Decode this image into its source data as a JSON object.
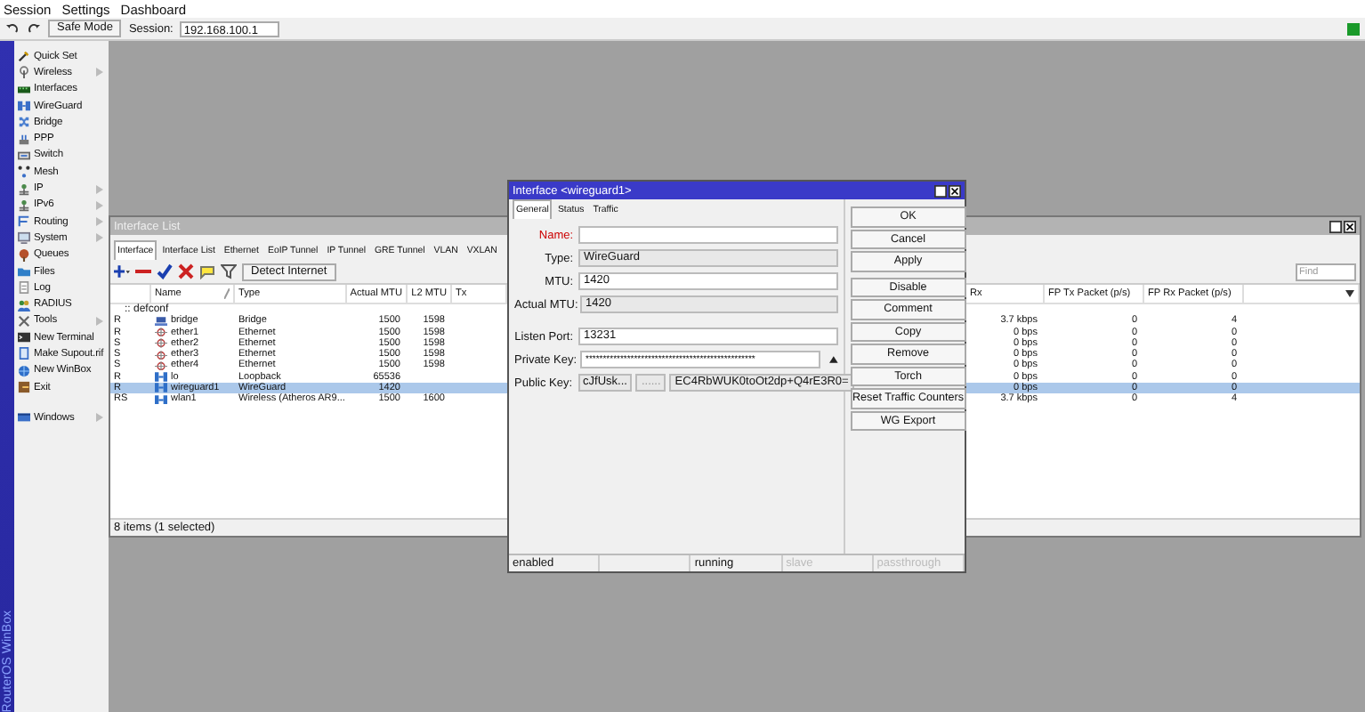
{
  "menu_bar": [
    "Session",
    "Settings",
    "Dashboard"
  ],
  "toolbar": {
    "safe_mode": "Safe Mode",
    "session_label": "Session:",
    "session_value": "192.168.100.1"
  },
  "sidebar": {
    "brand": "RouterOS WinBox",
    "items": [
      {
        "label": "Quick Set",
        "submenu": false
      },
      {
        "label": "Wireless",
        "submenu": true
      },
      {
        "label": "Interfaces",
        "submenu": false
      },
      {
        "label": "WireGuard",
        "submenu": false
      },
      {
        "label": "Bridge",
        "submenu": false
      },
      {
        "label": "PPP",
        "submenu": false
      },
      {
        "label": "Switch",
        "submenu": false
      },
      {
        "label": "Mesh",
        "submenu": false
      },
      {
        "label": "IP",
        "submenu": true
      },
      {
        "label": "IPv6",
        "submenu": true
      },
      {
        "label": "Routing",
        "submenu": true
      },
      {
        "label": "System",
        "submenu": true
      },
      {
        "label": "Queues",
        "submenu": false
      },
      {
        "label": "Files",
        "submenu": false
      },
      {
        "label": "Log",
        "submenu": false
      },
      {
        "label": "RADIUS",
        "submenu": false
      },
      {
        "label": "Tools",
        "submenu": true
      },
      {
        "label": "New Terminal",
        "submenu": false
      },
      {
        "label": "Make Supout.rif",
        "submenu": false
      },
      {
        "label": "New WinBox",
        "submenu": false
      },
      {
        "label": "Exit",
        "submenu": false
      }
    ],
    "bottom_items": [
      {
        "label": "Windows",
        "submenu": true
      }
    ]
  },
  "interface_list": {
    "title": "Interface List",
    "tabs": [
      {
        "label": "Interface",
        "selected": true
      },
      {
        "label": "Interface List",
        "selected": false
      },
      {
        "label": "Ethernet",
        "selected": false
      },
      {
        "label": "EoIP Tunnel",
        "selected": false
      },
      {
        "label": "IP Tunnel",
        "selected": false
      },
      {
        "label": "GRE Tunnel",
        "selected": false
      },
      {
        "label": "VLAN",
        "selected": false
      },
      {
        "label": "VXLAN",
        "selected": false
      }
    ],
    "detect_button": "Detect Internet",
    "find": {
      "placeholder": "Find"
    },
    "columns": [
      "Name",
      "Type",
      "Actual MTU",
      "L2 MTU",
      "Tx",
      "Rx",
      "FP Tx Packet (p/s)",
      "FP Rx Packet (p/s)"
    ],
    "group": ":: defconf",
    "rows": [
      {
        "flags": "R",
        "kind": "bridge",
        "name": "bridge",
        "type": "Bridge",
        "actual_mtu": "1500",
        "l2_mtu": "1598",
        "rx": "3.7 kbps",
        "fp_tx": "0",
        "fp_rx": "4",
        "selected": false
      },
      {
        "flags": "R",
        "kind": "ethernet",
        "name": "ether1",
        "type": "Ethernet",
        "actual_mtu": "1500",
        "l2_mtu": "1598",
        "rx": "0 bps",
        "fp_tx": "0",
        "fp_rx": "0",
        "selected": false
      },
      {
        "flags": "S",
        "kind": "ethernet",
        "name": "ether2",
        "type": "Ethernet",
        "actual_mtu": "1500",
        "l2_mtu": "1598",
        "rx": "0 bps",
        "fp_tx": "0",
        "fp_rx": "0",
        "selected": false
      },
      {
        "flags": "S",
        "kind": "ethernet",
        "name": "ether3",
        "type": "Ethernet",
        "actual_mtu": "1500",
        "l2_mtu": "1598",
        "rx": "0 bps",
        "fp_tx": "0",
        "fp_rx": "0",
        "selected": false
      },
      {
        "flags": "S",
        "kind": "ethernet",
        "name": "ether4",
        "type": "Ethernet",
        "actual_mtu": "1500",
        "l2_mtu": "1598",
        "rx": "0 bps",
        "fp_tx": "0",
        "fp_rx": "0",
        "selected": false
      },
      {
        "flags": "R",
        "kind": "link",
        "name": "lo",
        "type": "Loopback",
        "actual_mtu": "65536",
        "rx": "0 bps",
        "fp_tx": "0",
        "fp_rx": "0",
        "selected": false
      },
      {
        "flags": "R",
        "kind": "link",
        "name": "wireguard1",
        "type": "WireGuard",
        "actual_mtu": "1420",
        "rx": "0 bps",
        "fp_tx": "0",
        "fp_rx": "0",
        "selected": true
      },
      {
        "flags": "RS",
        "kind": "link",
        "name": "wlan1",
        "type": "Wireless (Atheros AR9...",
        "actual_mtu": "1500",
        "l2_mtu": "1600",
        "rx": "3.7 kbps",
        "fp_tx": "0",
        "fp_rx": "4",
        "selected": false
      }
    ],
    "status": "8 items (1 selected)"
  },
  "dialog": {
    "title": "Interface <wireguard1>",
    "tabs": [
      {
        "label": "General",
        "selected": true
      },
      {
        "label": "Status",
        "selected": false
      },
      {
        "label": "Traffic",
        "selected": false
      }
    ],
    "fields": [
      {
        "label": "Name:",
        "kind": "input",
        "required": true
      },
      {
        "label": "Type:",
        "kind": "readonly",
        "value": "WireGuard",
        "required": false
      },
      {
        "label": "MTU:",
        "kind": "input",
        "value": "1420",
        "required": false
      },
      {
        "label": "Actual MTU:",
        "kind": "readonly",
        "value": "1420",
        "required": false
      },
      {
        "label": "Listen Port:",
        "kind": "input",
        "value": "13231",
        "required": false
      },
      {
        "label": "Private Key:",
        "kind": "password",
        "value": "*************************************************",
        "required": false
      },
      {
        "label": "Public Key:",
        "kind": "split",
        "parts": [
          "cJfUsk...",
          "......",
          "EC4RbWUK0toOt2dp+Q4rE3R0="
        ],
        "required": false
      }
    ],
    "buttons": [
      "OK",
      "Cancel",
      "Apply",
      "Disable",
      "Comment",
      "Copy",
      "Remove",
      "Torch",
      "Reset Traffic Counters",
      "WG Export"
    ],
    "status_bar": [
      {
        "kind": "text",
        "text": "enabled",
        "disabled": false
      },
      {
        "kind": "empty"
      },
      {
        "kind": "text",
        "text": "running",
        "disabled": false
      },
      {
        "kind": "text",
        "text": "slave",
        "disabled": true
      },
      {
        "kind": "text",
        "text": "passthrough",
        "disabled": true
      }
    ]
  }
}
